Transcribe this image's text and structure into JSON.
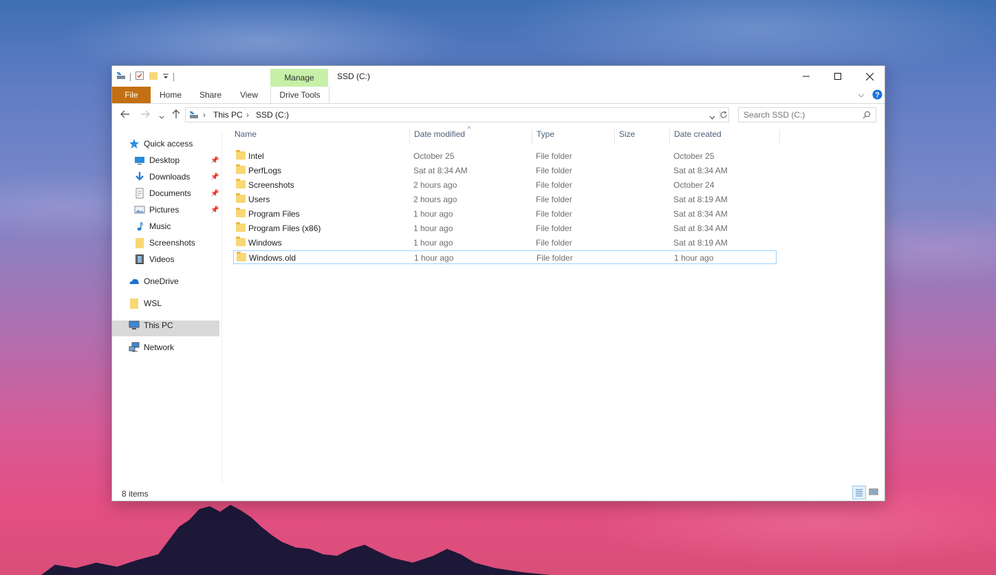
{
  "window": {
    "title": "SSD (C:)",
    "contextual_tab": "Manage"
  },
  "ribbon": {
    "tabs": [
      "File",
      "Home",
      "Share",
      "View",
      "Drive Tools"
    ]
  },
  "address": {
    "crumbs": [
      "This PC",
      "SSD (C:)"
    ],
    "search_placeholder": "Search SSD (C:)"
  },
  "nav": {
    "quick_access": "Quick access",
    "pinned": [
      {
        "label": "Desktop",
        "icon": "desktop-icon"
      },
      {
        "label": "Downloads",
        "icon": "downloads-icon"
      },
      {
        "label": "Documents",
        "icon": "documents-icon"
      },
      {
        "label": "Pictures",
        "icon": "pictures-icon"
      }
    ],
    "unpinned": [
      {
        "label": "Music",
        "icon": "music-icon"
      },
      {
        "label": "Screenshots",
        "icon": "folder-icon"
      },
      {
        "label": "Videos",
        "icon": "videos-icon"
      }
    ],
    "onedrive": "OneDrive",
    "wsl": "WSL",
    "this_pc": "This PC",
    "network": "Network"
  },
  "columns": [
    "Name",
    "Date modified",
    "Type",
    "Size",
    "Date created"
  ],
  "files": [
    {
      "name": "Intel",
      "modified": "October 25",
      "type": "File folder",
      "size": "",
      "created": "October 25"
    },
    {
      "name": "PerfLogs",
      "modified": "Sat at 8:34 AM",
      "type": "File folder",
      "size": "",
      "created": "Sat at 8:34 AM"
    },
    {
      "name": "Screenshots",
      "modified": "2 hours ago",
      "type": "File folder",
      "size": "",
      "created": "October 24"
    },
    {
      "name": "Users",
      "modified": "2 hours ago",
      "type": "File folder",
      "size": "",
      "created": "Sat at 8:19 AM"
    },
    {
      "name": "Program Files",
      "modified": "1 hour ago",
      "type": "File folder",
      "size": "",
      "created": "Sat at 8:34 AM"
    },
    {
      "name": "Program Files (x86)",
      "modified": "1 hour ago",
      "type": "File folder",
      "size": "",
      "created": "Sat at 8:34 AM"
    },
    {
      "name": "Windows",
      "modified": "1 hour ago",
      "type": "File folder",
      "size": "",
      "created": "Sat at 8:19 AM"
    },
    {
      "name": "Windows.old",
      "modified": "1 hour ago",
      "type": "File folder",
      "size": "",
      "created": "1 hour ago"
    }
  ],
  "status": {
    "item_count": "8 items"
  }
}
